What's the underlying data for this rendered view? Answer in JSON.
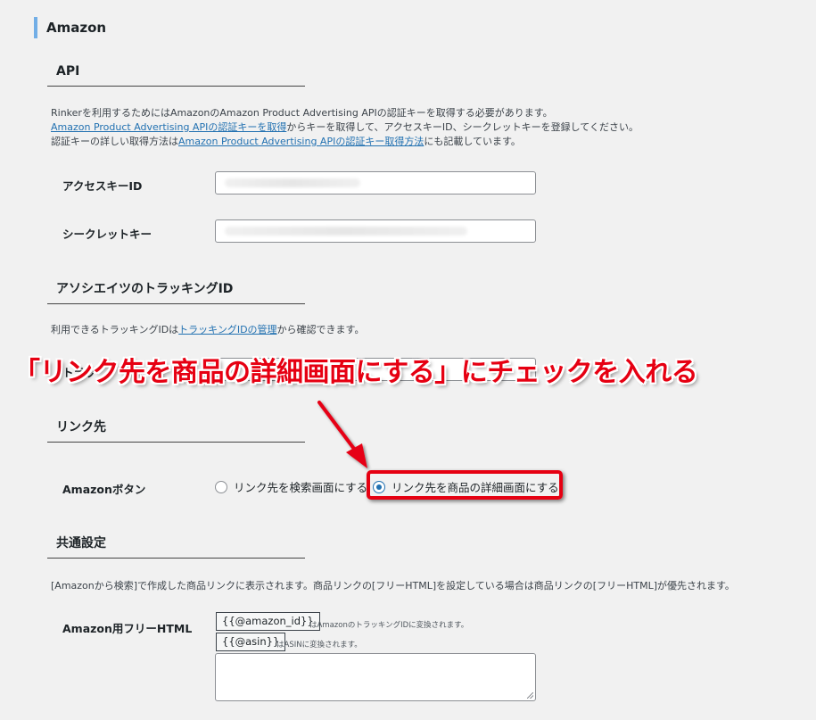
{
  "section": {
    "title": "Amazon"
  },
  "api": {
    "heading": "API",
    "desc_line1": "Rinkerを利用するためにはAmazonのAmazon Product Advertising APIの認証キーを取得する必要があります。",
    "desc_line2_link": "Amazon Product Advertising APIの認証キーを取得",
    "desc_line2_rest": "からキーを取得して、アクセスキーID、シークレットキーを登録してください。",
    "desc_line3_pre": "認証キーの詳しい取得方法は",
    "desc_line3_link": "Amazon Product Advertising APIの認証キー取得方法",
    "desc_line3_post": "にも記載しています。",
    "access_key_label": "アクセスキーID",
    "secret_key_label": "シークレットキー"
  },
  "tracking": {
    "heading": "アソシエイツのトラッキングID",
    "desc_pre": "利用できるトラッキングIDは",
    "desc_link": "トラッキングIDの管理",
    "desc_post": "から確認できます。",
    "field_label_fragment": "トラッ"
  },
  "link_dest": {
    "heading": "リンク先",
    "label": "Amazonボタン",
    "options": [
      {
        "label": "リンク先を検索画面にする",
        "selected": false
      },
      {
        "label": "リンク先を商品の詳細画面にする",
        "selected": true
      }
    ]
  },
  "common": {
    "heading": "共通設定",
    "desc": "[Amazonから検索]で作成した商品リンクに表示されます。商品リンクの[フリーHTML]を設定している場合は商品リンクの[フリーHTML]が優先されます。",
    "free_html_label": "Amazon用フリーHTML",
    "tags": [
      {
        "button": "{{@amazon_id}}",
        "note": "はAmazonのトラッキングIDに変換されます。"
      },
      {
        "button": "{{@asin}}",
        "note": "はASINに変換されます。"
      }
    ]
  },
  "annotation": {
    "text": "「リンク先を商品の詳細画面にする」にチェックを入れる",
    "color": "#e60012"
  }
}
